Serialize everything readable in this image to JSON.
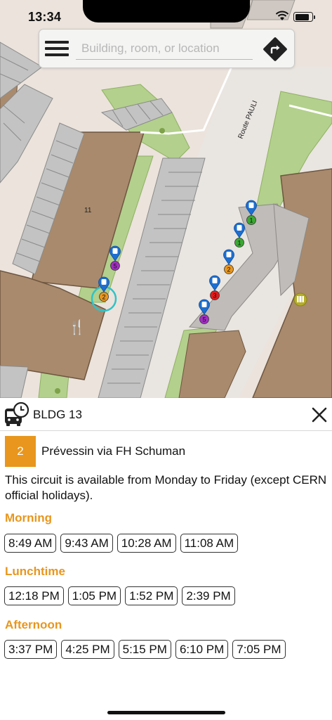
{
  "status_bar": {
    "time": "13:34"
  },
  "search": {
    "placeholder": "Building, room, or location"
  },
  "map": {
    "building_label": "11",
    "road_label": "Route PAULI",
    "markers": [
      {
        "label": "1",
        "color": "#3aa932"
      },
      {
        "label": "1",
        "color": "#3aa932"
      },
      {
        "label": "2",
        "color": "#e8961d"
      },
      {
        "label": "3",
        "color": "#e01c1c"
      },
      {
        "label": "5",
        "color": "#a22ec2"
      },
      {
        "label": "5",
        "color": "#a22ec2"
      },
      {
        "label": "2",
        "color": "#e8961d"
      }
    ]
  },
  "sheet": {
    "title": "BLDG 13",
    "route": {
      "number": "2",
      "name": "Prévessin via FH Schuman",
      "color": "#e8961d"
    },
    "description": "This circuit is available from Monday to Friday (except CERN official holidays).",
    "sections": [
      {
        "label": "Morning",
        "times": [
          "8:49 AM",
          "9:43 AM",
          "10:28 AM",
          "11:08 AM"
        ]
      },
      {
        "label": "Lunchtime",
        "times": [
          "12:18 PM",
          "1:05 PM",
          "1:52 PM",
          "2:39 PM"
        ]
      },
      {
        "label": "Afternoon",
        "times": [
          "3:37 PM",
          "4:25 PM",
          "5:15 PM",
          "6:10 PM",
          "7:05 PM"
        ]
      }
    ]
  },
  "colors": {
    "accent": "#e8961d",
    "map_background": "#ebe3dc",
    "building": "#a98a6c",
    "grass": "#b3d08c",
    "parking": "#c3c3c3"
  }
}
